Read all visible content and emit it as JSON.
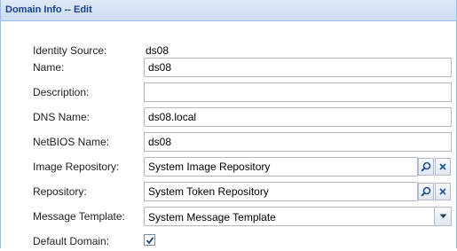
{
  "panel": {
    "title": "Domain Info -- Edit"
  },
  "form": {
    "identity_source": {
      "label": "Identity Source:",
      "value": "ds08"
    },
    "name": {
      "label": "Name:",
      "value": "ds08"
    },
    "description": {
      "label": "Description:",
      "value": ""
    },
    "dns_name": {
      "label": "DNS Name:",
      "value": "ds08.local"
    },
    "netbios_name": {
      "label": "NetBIOS Name:",
      "value": "ds08"
    },
    "image_repository": {
      "label": "Image Repository:",
      "value": "System Image Repository"
    },
    "repository": {
      "label": "Repository:",
      "value": "System Token Repository"
    },
    "message_template": {
      "label": "Message Template:",
      "value": "System Message Template"
    },
    "default_domain": {
      "label": "Default Domain:",
      "checked": true
    }
  },
  "icons": {
    "search": "search-icon",
    "clear": "clear-icon",
    "dropdown": "chevron-down-icon",
    "check": "checkmark-icon"
  },
  "colors": {
    "header_text": "#15428b",
    "header_bg": "#dfe8f6",
    "border": "#99bbe8",
    "field_border": "#b5b8c8"
  }
}
